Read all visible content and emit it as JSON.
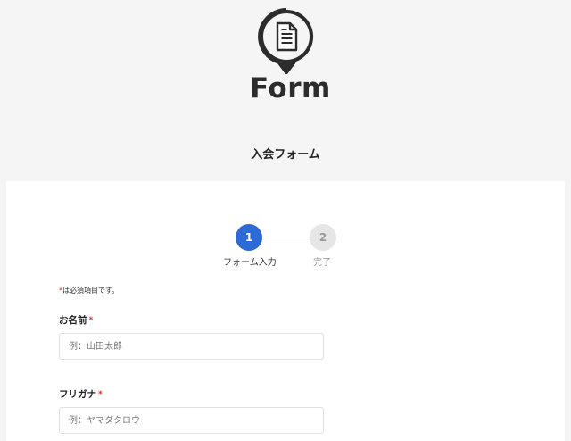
{
  "header": {
    "logo_text": "Form",
    "logo_icon": "document-speech-bubble-icon"
  },
  "form_title": "入会フォーム",
  "stepper": {
    "steps": [
      {
        "number": "1",
        "label": "フォーム入力",
        "state": "active"
      },
      {
        "number": "2",
        "label": "完了",
        "state": "inactive"
      }
    ]
  },
  "required_note": {
    "marker": "*",
    "text": "は必須項目です。"
  },
  "fields": {
    "name": {
      "label": "お名前",
      "required_marker": "*",
      "value": "",
      "placeholder": "例：山田太郎"
    },
    "furigana": {
      "label": "フリガナ",
      "required_marker": "*",
      "value": "",
      "placeholder": "例：ヤマダタロウ"
    }
  },
  "colors": {
    "background": "#f5f5f5",
    "card": "#ffffff",
    "accent": "#2d6ad6",
    "inactive_step": "#e6e6e6",
    "required": "#d32f2f"
  }
}
